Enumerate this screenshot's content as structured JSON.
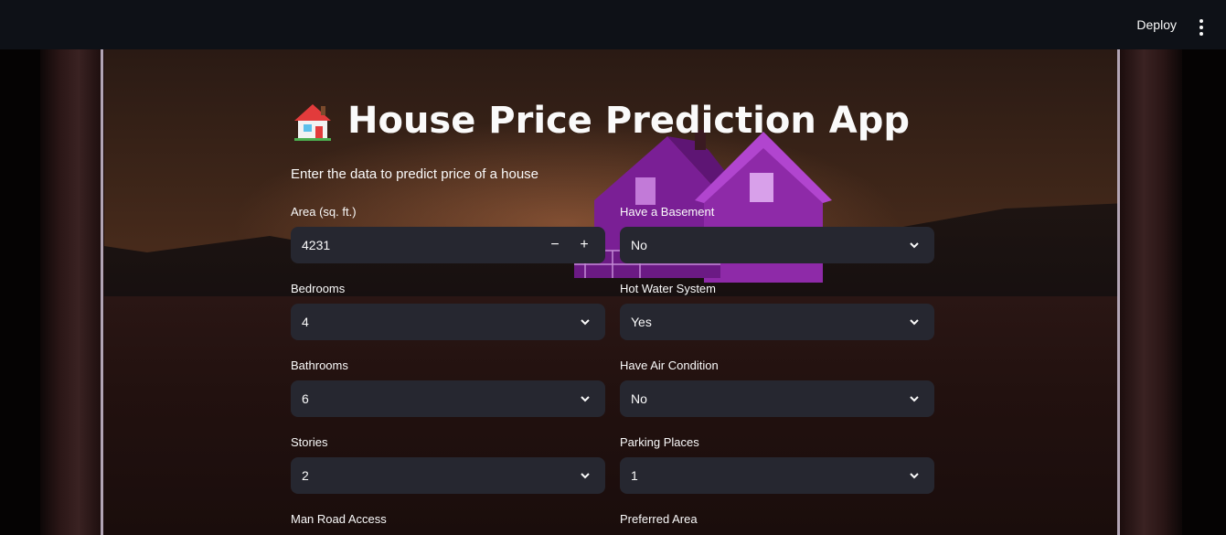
{
  "topbar": {
    "deploy_label": "Deploy",
    "menu_icon": "more-vertical-icon"
  },
  "header": {
    "title_emoji": "house-icon",
    "title": "House Price Prediction App",
    "subtitle": "Enter the data to predict price of a house"
  },
  "form": {
    "area": {
      "label": "Area (sq. ft.)",
      "value": "4231",
      "minus": "−",
      "plus": "+"
    },
    "basement": {
      "label": "Have a Basement",
      "value": "No"
    },
    "bedrooms": {
      "label": "Bedrooms",
      "value": "4"
    },
    "hot_water": {
      "label": "Hot Water System",
      "value": "Yes"
    },
    "bathrooms": {
      "label": "Bathrooms",
      "value": "6"
    },
    "air_condition": {
      "label": "Have Air Condition",
      "value": "No"
    },
    "stories": {
      "label": "Stories",
      "value": "2"
    },
    "parking": {
      "label": "Parking Places",
      "value": "1"
    },
    "main_road": {
      "label": "Man Road Access"
    },
    "preferred_area": {
      "label": "Preferred Area"
    }
  },
  "colors": {
    "topbar": "#0e1117",
    "input_bg": "#262730",
    "text": "#fafafa",
    "house": "#8e2aa8"
  }
}
